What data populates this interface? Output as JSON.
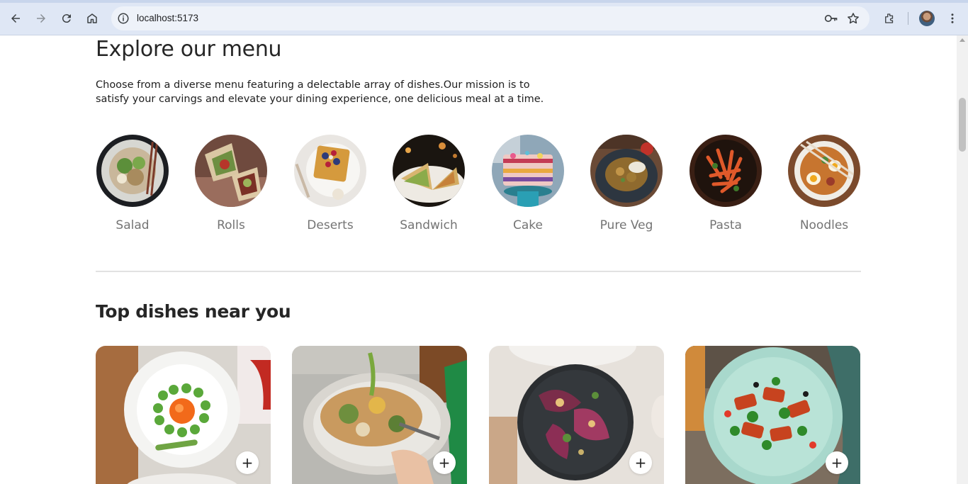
{
  "browser": {
    "url": "localhost:5173",
    "icons": [
      "back-icon",
      "forward-icon",
      "reload-icon",
      "home-icon",
      "site-info-icon",
      "password-key-icon",
      "bookmark-star-icon",
      "extensions-icon",
      "profile-avatar",
      "more-menu-icon"
    ]
  },
  "explore": {
    "title": "Explore our menu",
    "text": "Choose from a diverse menu featuring a delectable array of dishes.Our mission is to satisfy your carvings and elevate your dining experience, one delicious meal at a time."
  },
  "menu": {
    "items": [
      {
        "label": "Salad"
      },
      {
        "label": "Rolls"
      },
      {
        "label": "Deserts"
      },
      {
        "label": "Sandwich"
      },
      {
        "label": "Cake"
      },
      {
        "label": "Pure Veg"
      },
      {
        "label": "Pasta"
      },
      {
        "label": "Noodles"
      }
    ]
  },
  "top_dishes": {
    "title": "Top dishes near you",
    "add_label": "+"
  }
}
